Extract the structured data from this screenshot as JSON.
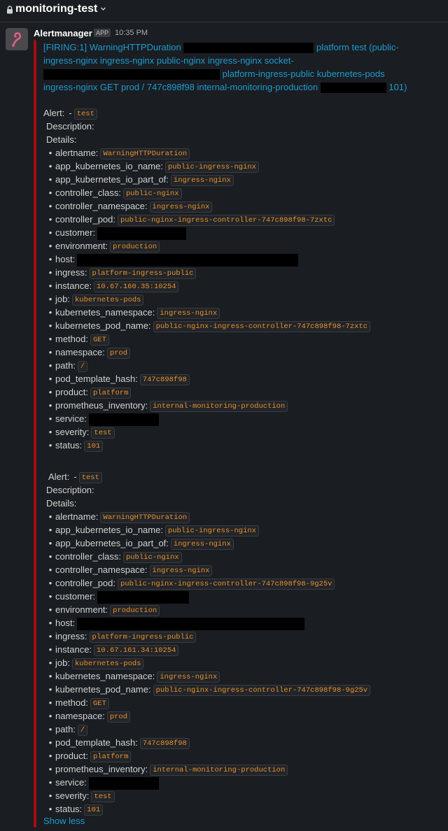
{
  "channel": {
    "name": "monitoring-test",
    "lock_icon": "lock-icon",
    "chevron_icon": "chevron-down-icon"
  },
  "message": {
    "sender": "Alertmanager",
    "badge": "APP",
    "time": "10:35 PM",
    "avatar_icon": "prometheus-logo-icon",
    "accent_color": "#a40d12",
    "title_part1": "[FIRING:1] WarningHTTPDuration",
    "title_part2": "platform test",
    "title_part3": "(public-ingress-nginx ingress-nginx public-nginx ingress-nginx socket-",
    "title_part4": "platform-ingress-public kubernetes-pods",
    "title_part5": "ingress-nginx GET prod / 747c898f98 internal-monitoring-production",
    "title_part6": "101)",
    "show_less": "Show less"
  },
  "alerts": [
    {
      "alert_label": "Alert:",
      "alert_dash": "-",
      "alert_value": "test",
      "description_label": "Description:",
      "details_label": "Details:",
      "details": [
        {
          "key": "alertname:",
          "value": "WarningHTTPDuration"
        },
        {
          "key": "app_kubernetes_io_name:",
          "value": "public-ingress-nginx"
        },
        {
          "key": "app_kubernetes_io_part_of:",
          "value": "ingress-nginx"
        },
        {
          "key": "controller_class:",
          "value": "public-nginx"
        },
        {
          "key": "controller_namespace:",
          "value": "ingress-nginx"
        },
        {
          "key": "controller_pod:",
          "value": "public-nginx-ingress-controller-747c898f98-7zxtc"
        },
        {
          "key": "customer:",
          "value": ""
        },
        {
          "key": "environment:",
          "value": "production"
        },
        {
          "key": "host:",
          "value": ""
        },
        {
          "key": "ingress:",
          "value": "platform-ingress-public"
        },
        {
          "key": "instance:",
          "value": "10.67.160.35:10254"
        },
        {
          "key": "job:",
          "value": "kubernetes-pods"
        },
        {
          "key": "kubernetes_namespace:",
          "value": "ingress-nginx"
        },
        {
          "key": "kubernetes_pod_name:",
          "value": "public-nginx-ingress-controller-747c898f98-7zxtc"
        },
        {
          "key": "method:",
          "value": "GET"
        },
        {
          "key": "namespace:",
          "value": "prod"
        },
        {
          "key": "path:",
          "value": "/"
        },
        {
          "key": "pod_template_hash:",
          "value": "747c898f98"
        },
        {
          "key": "product:",
          "value": "platform"
        },
        {
          "key": "prometheus_inventory:",
          "value": "internal-monitoring-production"
        },
        {
          "key": "service:",
          "value": ""
        },
        {
          "key": "severity:",
          "value": "test"
        },
        {
          "key": "status:",
          "value": "101"
        }
      ]
    },
    {
      "alert_label": "Alert:",
      "alert_dash": "-",
      "alert_value": "test",
      "description_label": "Description:",
      "details_label": "Details:",
      "details": [
        {
          "key": "alertname:",
          "value": "WarningHTTPDuration"
        },
        {
          "key": "app_kubernetes_io_name:",
          "value": "public-ingress-nginx"
        },
        {
          "key": "app_kubernetes_io_part_of:",
          "value": "ingress-nginx"
        },
        {
          "key": "controller_class:",
          "value": "public-nginx"
        },
        {
          "key": "controller_namespace:",
          "value": "ingress-nginx"
        },
        {
          "key": "controller_pod:",
          "value": "public-nginx-ingress-controller-747c898f98-9g25v"
        },
        {
          "key": "customer:",
          "value": ""
        },
        {
          "key": "environment:",
          "value": "production"
        },
        {
          "key": "host:",
          "value": ""
        },
        {
          "key": "ingress:",
          "value": "platform-ingress-public"
        },
        {
          "key": "instance:",
          "value": "10.67.161.34:10254"
        },
        {
          "key": "job:",
          "value": "kubernetes-pods"
        },
        {
          "key": "kubernetes_namespace:",
          "value": "ingress-nginx"
        },
        {
          "key": "kubernetes_pod_name:",
          "value": "public-nginx-ingress-controller-747c898f98-9g25v"
        },
        {
          "key": "method:",
          "value": "GET"
        },
        {
          "key": "namespace:",
          "value": "prod"
        },
        {
          "key": "path:",
          "value": "/"
        },
        {
          "key": "pod_template_hash:",
          "value": "747c898f98"
        },
        {
          "key": "product:",
          "value": "platform"
        },
        {
          "key": "prometheus_inventory:",
          "value": "internal-monitoring-production"
        },
        {
          "key": "service:",
          "value": ""
        },
        {
          "key": "severity:",
          "value": "test"
        },
        {
          "key": "status:",
          "value": "101"
        }
      ]
    }
  ]
}
